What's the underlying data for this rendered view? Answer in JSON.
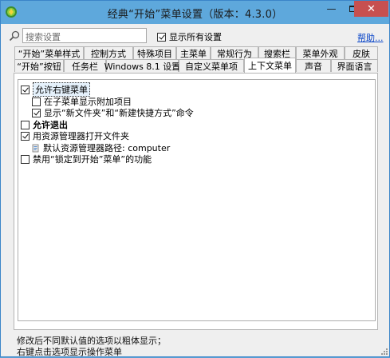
{
  "window": {
    "title": "经典“开始”菜单设置（版本：4.3.0）",
    "minimize_glyph": "—",
    "close_glyph": "✕"
  },
  "toolbar": {
    "search_placeholder": "搜索设置",
    "show_all_label": "显示所有设置",
    "show_all_checked": true,
    "help_label": "帮助..."
  },
  "tabs": {
    "row1": [
      "“开始”菜单样式",
      "控制方式",
      "特殊项目",
      "主菜单",
      "常规行为",
      "搜索栏",
      "菜单外观",
      "皮肤"
    ],
    "row2": [
      "“开始”按钮",
      "任务栏",
      "Windows 8.1 设置",
      "自定义菜单项",
      "上下文菜单",
      "声音",
      "界面语言"
    ],
    "active": "上下文菜单"
  },
  "settings": [
    {
      "label": "允许右键菜单",
      "checked": true,
      "bold": false,
      "indent": 0,
      "selected": true
    },
    {
      "label": "在子菜单显示附加项目",
      "checked": false,
      "bold": false,
      "indent": 1
    },
    {
      "label": "显示“新文件夹”和“新建快捷方式”命令",
      "checked": true,
      "bold": false,
      "indent": 1
    },
    {
      "label": "允许退出",
      "checked": false,
      "bold": true,
      "indent": 0
    },
    {
      "label": "用资源管理器打开文件夹",
      "checked": true,
      "bold": false,
      "indent": 0
    },
    {
      "label": "默认资源管理器路径: computer",
      "icon": "folder-icon",
      "indent": 1
    },
    {
      "label": "禁用“锁定到开始”菜单”的功能",
      "checked": false,
      "bold": false,
      "indent": 0
    }
  ],
  "footer": {
    "line1": "修改后不同默认值的选项以粗体显示；",
    "line2": "右键点击选项显示操作菜单"
  },
  "colors": {
    "titlebar": "#5ea8dc",
    "close_button": "#c75050",
    "link": "#0b46c8"
  }
}
